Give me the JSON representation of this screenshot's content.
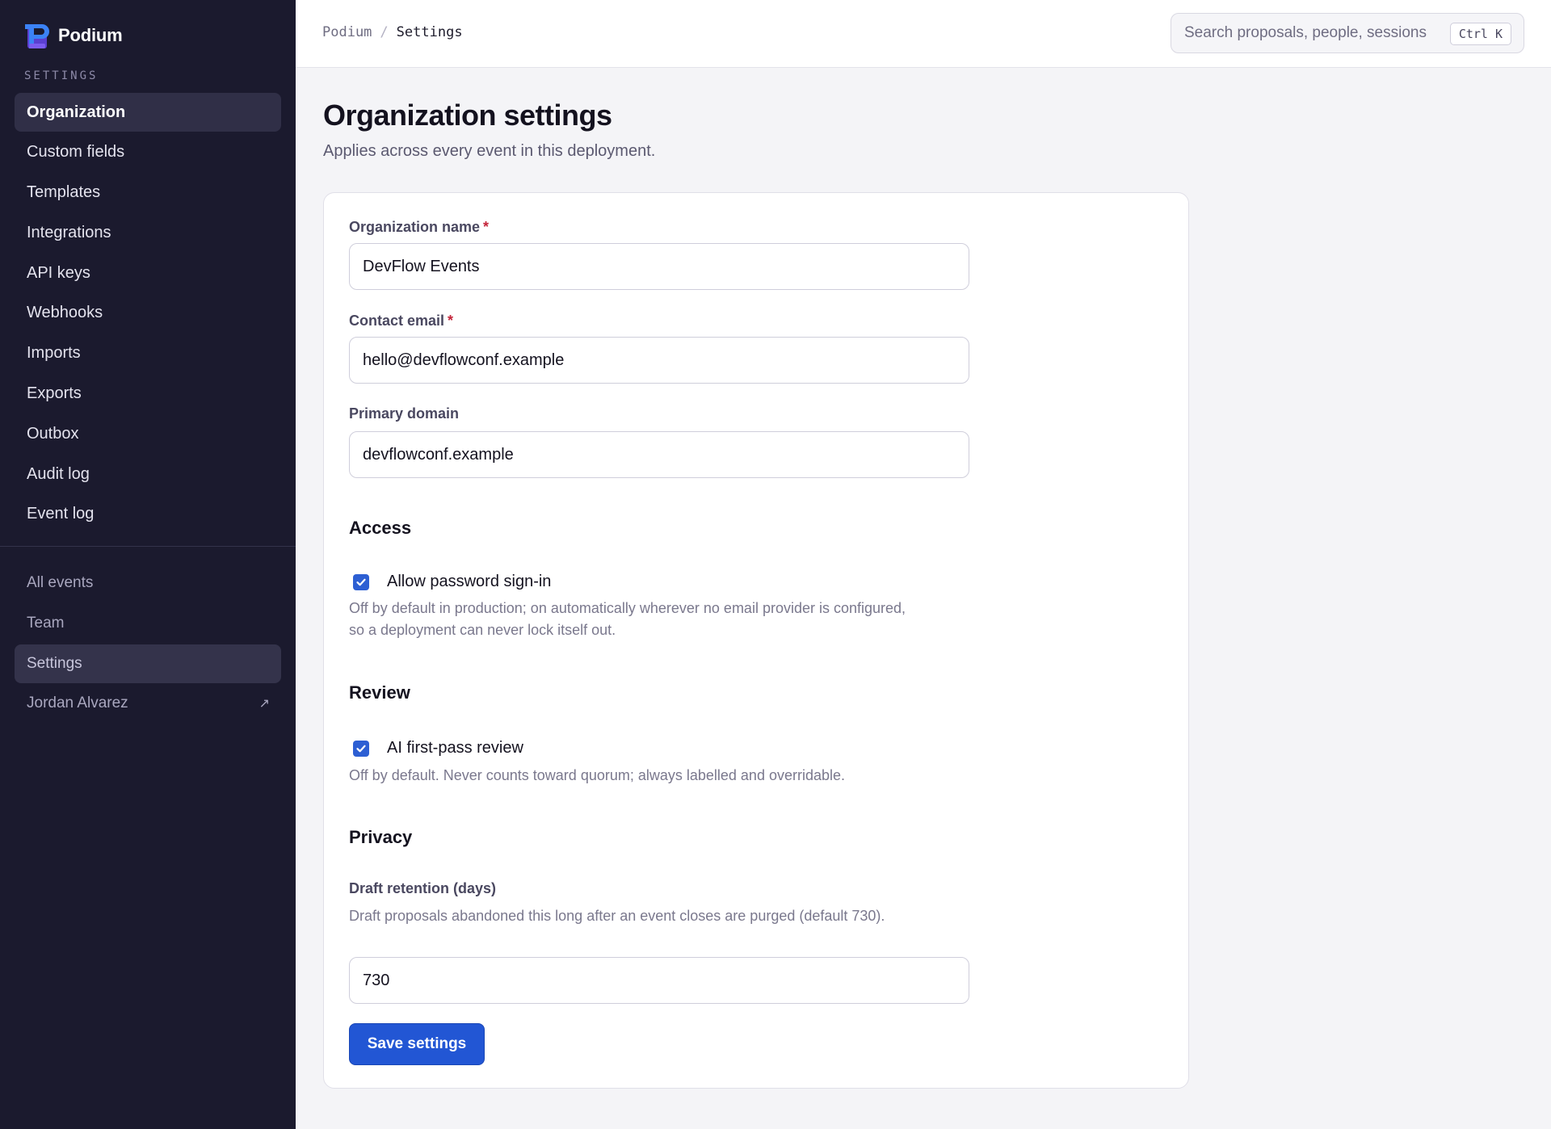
{
  "app": {
    "name": "Podium"
  },
  "sidebar": {
    "section_label": "SETTINGS",
    "settings_items": [
      {
        "label": "Organization",
        "active": true
      },
      {
        "label": "Custom fields"
      },
      {
        "label": "Templates"
      },
      {
        "label": "Integrations"
      },
      {
        "label": "API keys"
      },
      {
        "label": "Webhooks"
      },
      {
        "label": "Imports"
      },
      {
        "label": "Exports"
      },
      {
        "label": "Outbox"
      },
      {
        "label": "Audit log"
      },
      {
        "label": "Event log"
      }
    ],
    "bottom_items": [
      {
        "label": "All events"
      },
      {
        "label": "Team"
      },
      {
        "label": "Settings",
        "active": true
      }
    ],
    "user": {
      "name": "Jordan Alvarez",
      "icon": "external-link-icon"
    }
  },
  "topbar": {
    "breadcrumb": {
      "root": "Podium",
      "separator": "/",
      "current": "Settings"
    },
    "search": {
      "placeholder": "Search proposals, people, sessions",
      "shortcut": "Ctrl K"
    }
  },
  "page": {
    "title": "Organization settings",
    "subtitle": "Applies across every event in this deployment."
  },
  "form": {
    "org_name": {
      "label": "Organization name",
      "required_mark": "*",
      "value": "DevFlow Events"
    },
    "contact_email": {
      "label": "Contact email",
      "required_mark": "*",
      "value": "hello@devflowconf.example"
    },
    "primary_domain": {
      "label": "Primary domain",
      "value": "devflowconf.example"
    },
    "access": {
      "heading": "Access",
      "password_signin": {
        "label": "Allow password sign-in",
        "checked": true,
        "help": "Off by default in production; on automatically wherever no email provider is configured, so a deployment can never lock itself out."
      }
    },
    "review": {
      "heading": "Review",
      "ai_review": {
        "label": "AI first-pass review",
        "checked": true,
        "help": "Off by default. Never counts toward quorum; always labelled and overridable."
      }
    },
    "privacy": {
      "heading": "Privacy",
      "draft_retention": {
        "label": "Draft retention (days)",
        "help": "Draft proposals abandoned this long after an event closes are purged (default 730).",
        "value": "730"
      }
    },
    "save_label": "Save settings"
  },
  "colors": {
    "sidebar_bg": "#1b1a2e",
    "accent": "#2256d4",
    "required": "#c4253a",
    "page_bg": "#f4f4f7"
  }
}
